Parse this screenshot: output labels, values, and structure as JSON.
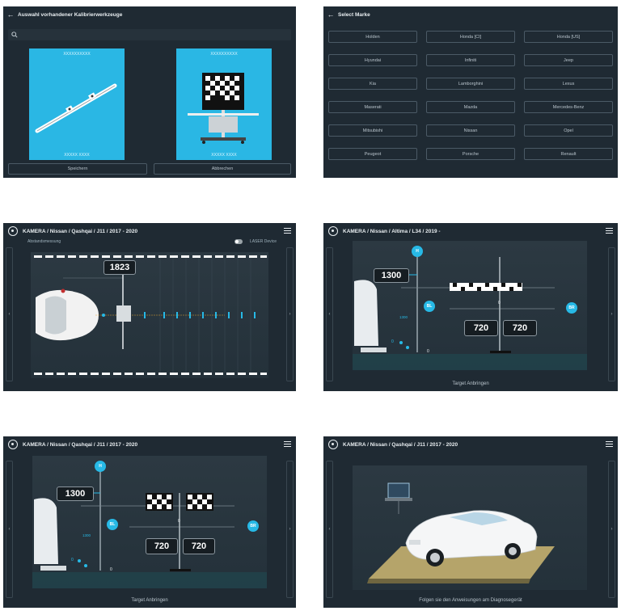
{
  "panel1": {
    "back_icon": "arrow-left-icon",
    "title": "Auswahl vorhandener Kalibrierwerkzeuge",
    "search_icon": "search-icon",
    "card1": {
      "code_top": "XXXXXXXXXX",
      "code_bottom": "XXXXX XXXX"
    },
    "card2": {
      "code_top": "XXXXXXXXXX",
      "code_bottom": "XXXXX XXXX"
    },
    "save_label": "Speichern",
    "cancel_label": "Abbrechen"
  },
  "panel2": {
    "back_icon": "arrow-left-icon",
    "title": "Select Marke",
    "brands": [
      "Holden",
      "Honda [CI]",
      "Honda [US]",
      "Hyundai",
      "Infiniti",
      "Jeep",
      "Kia",
      "Lamborghini",
      "Lexus",
      "Maserati",
      "Mazda",
      "Mercedes-Benz",
      "Mitsubishi",
      "Nissan",
      "Opel",
      "Peugeot",
      "Porsche",
      "Renault"
    ]
  },
  "panel3": {
    "title": "KAMERA / Nissan / Qashqai / J11 / 2017 - 2020",
    "subtitle": "Abstandsmessung",
    "laser_label": "LASER Device",
    "distance_value": "1823",
    "left_arrow": "‹",
    "right_arrow": "›"
  },
  "panel4": {
    "title": "KAMERA / Nissan / Altima / L34 / 2019 -",
    "h_label": "H",
    "bl_label": "BL",
    "br_label": "BR",
    "height_value": "1300",
    "height_small": "1300",
    "zero_center": "0",
    "zero_bottom": "0",
    "zero_small": "0",
    "left_value": "720",
    "right_value": "720",
    "caption": "Target Anbringen",
    "left_arrow": "‹",
    "right_arrow": "›"
  },
  "panel5": {
    "title": "KAMERA / Nissan / Qashqai / J11 / 2017 - 2020",
    "h_label": "H",
    "bl_label": "BL",
    "br_label": "BR",
    "height_value": "1300",
    "height_small": "1300",
    "zero_center": "0",
    "zero_bottom": "0",
    "zero_small": "0",
    "left_value": "720",
    "right_value": "720",
    "caption": "Target Anbringen",
    "left_arrow": "‹",
    "right_arrow": "›"
  },
  "panel6": {
    "title": "KAMERA / Nissan / Qashqai / J11 / 2017 - 2020",
    "caption": "Folgen sie den Anweisungen am Diagnosegerät",
    "left_arrow": "‹",
    "right_arrow": "›"
  },
  "colors": {
    "panel_bg": "#1f2a33",
    "accent_cyan": "#27b9e6",
    "text": "#e8edf0"
  }
}
